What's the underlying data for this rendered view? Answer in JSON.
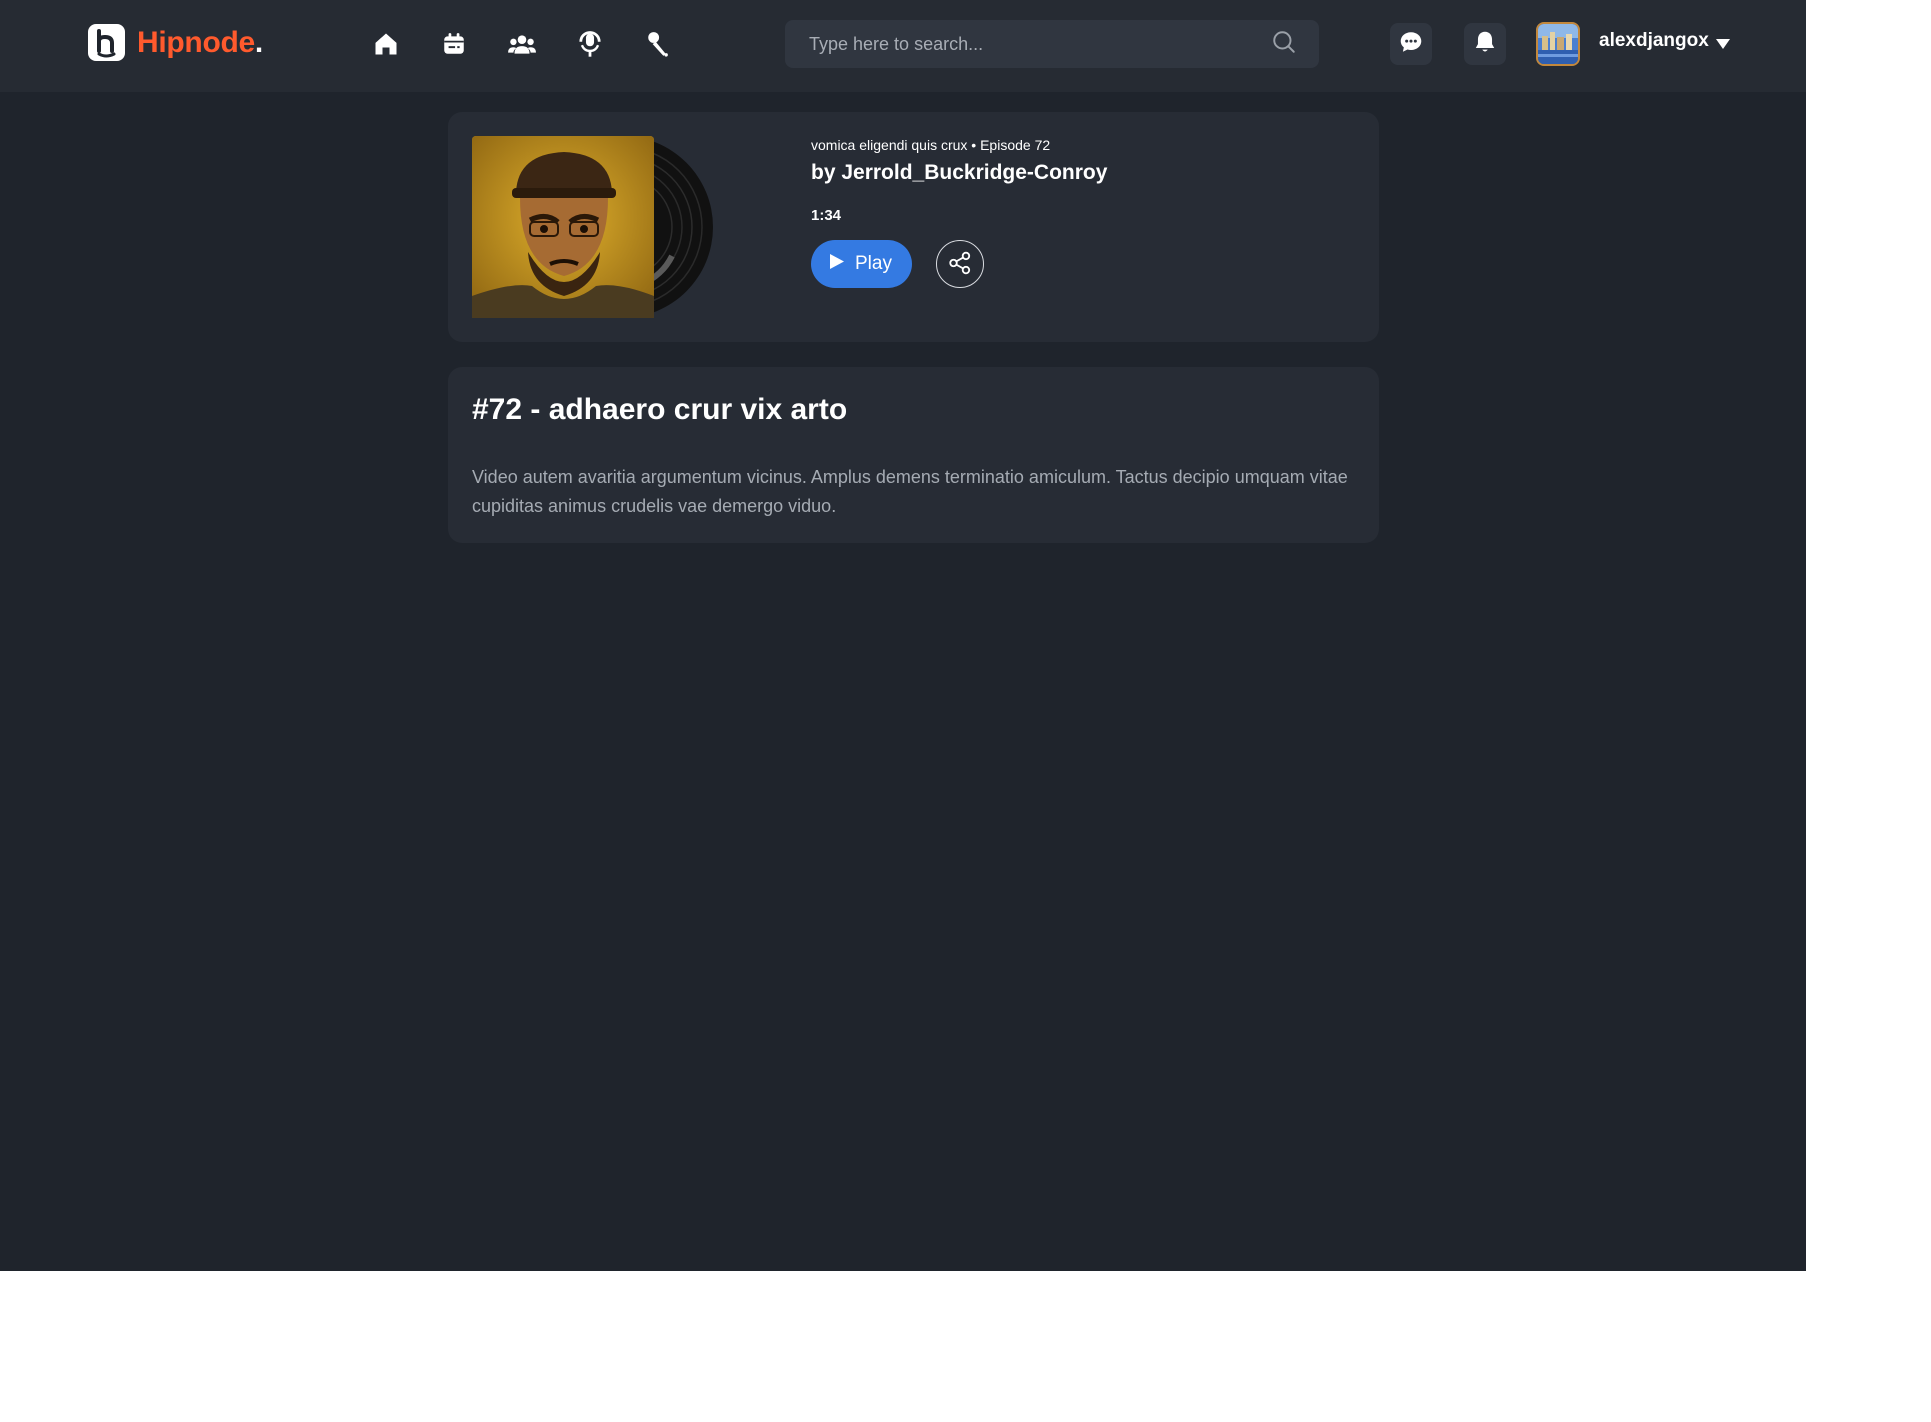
{
  "brand": {
    "name": "Hipnode",
    "dot": ".",
    "color": "#ff5a2d"
  },
  "nav": [
    {
      "icon": "home-icon",
      "label": "Home"
    },
    {
      "icon": "calendar-icon",
      "label": "Meetups"
    },
    {
      "icon": "groups-icon",
      "label": "Groups"
    },
    {
      "icon": "podcast-icon",
      "label": "Podcasts"
    },
    {
      "icon": "interview-icon",
      "label": "Interviews"
    }
  ],
  "search": {
    "placeholder": "Type here to search..."
  },
  "user": {
    "name": "alexdjangox"
  },
  "episode": {
    "meta": "vomica eligendi quis crux • Episode 72",
    "author": "by Jerrold_Buckridge-Conroy",
    "duration": "1:34",
    "play_label": "Play",
    "title": "#72 - adhaero crur vix arto",
    "description": "Video autem avaritia argumentum vicinus. Amplus demens terminatio amiculum. Tactus decipio umquam vitae cupiditas animus crudelis vae demergo viduo."
  },
  "colors": {
    "background": "#1f242c",
    "header": "#262b33",
    "card": "#272c35",
    "accent": "#347ae2"
  }
}
